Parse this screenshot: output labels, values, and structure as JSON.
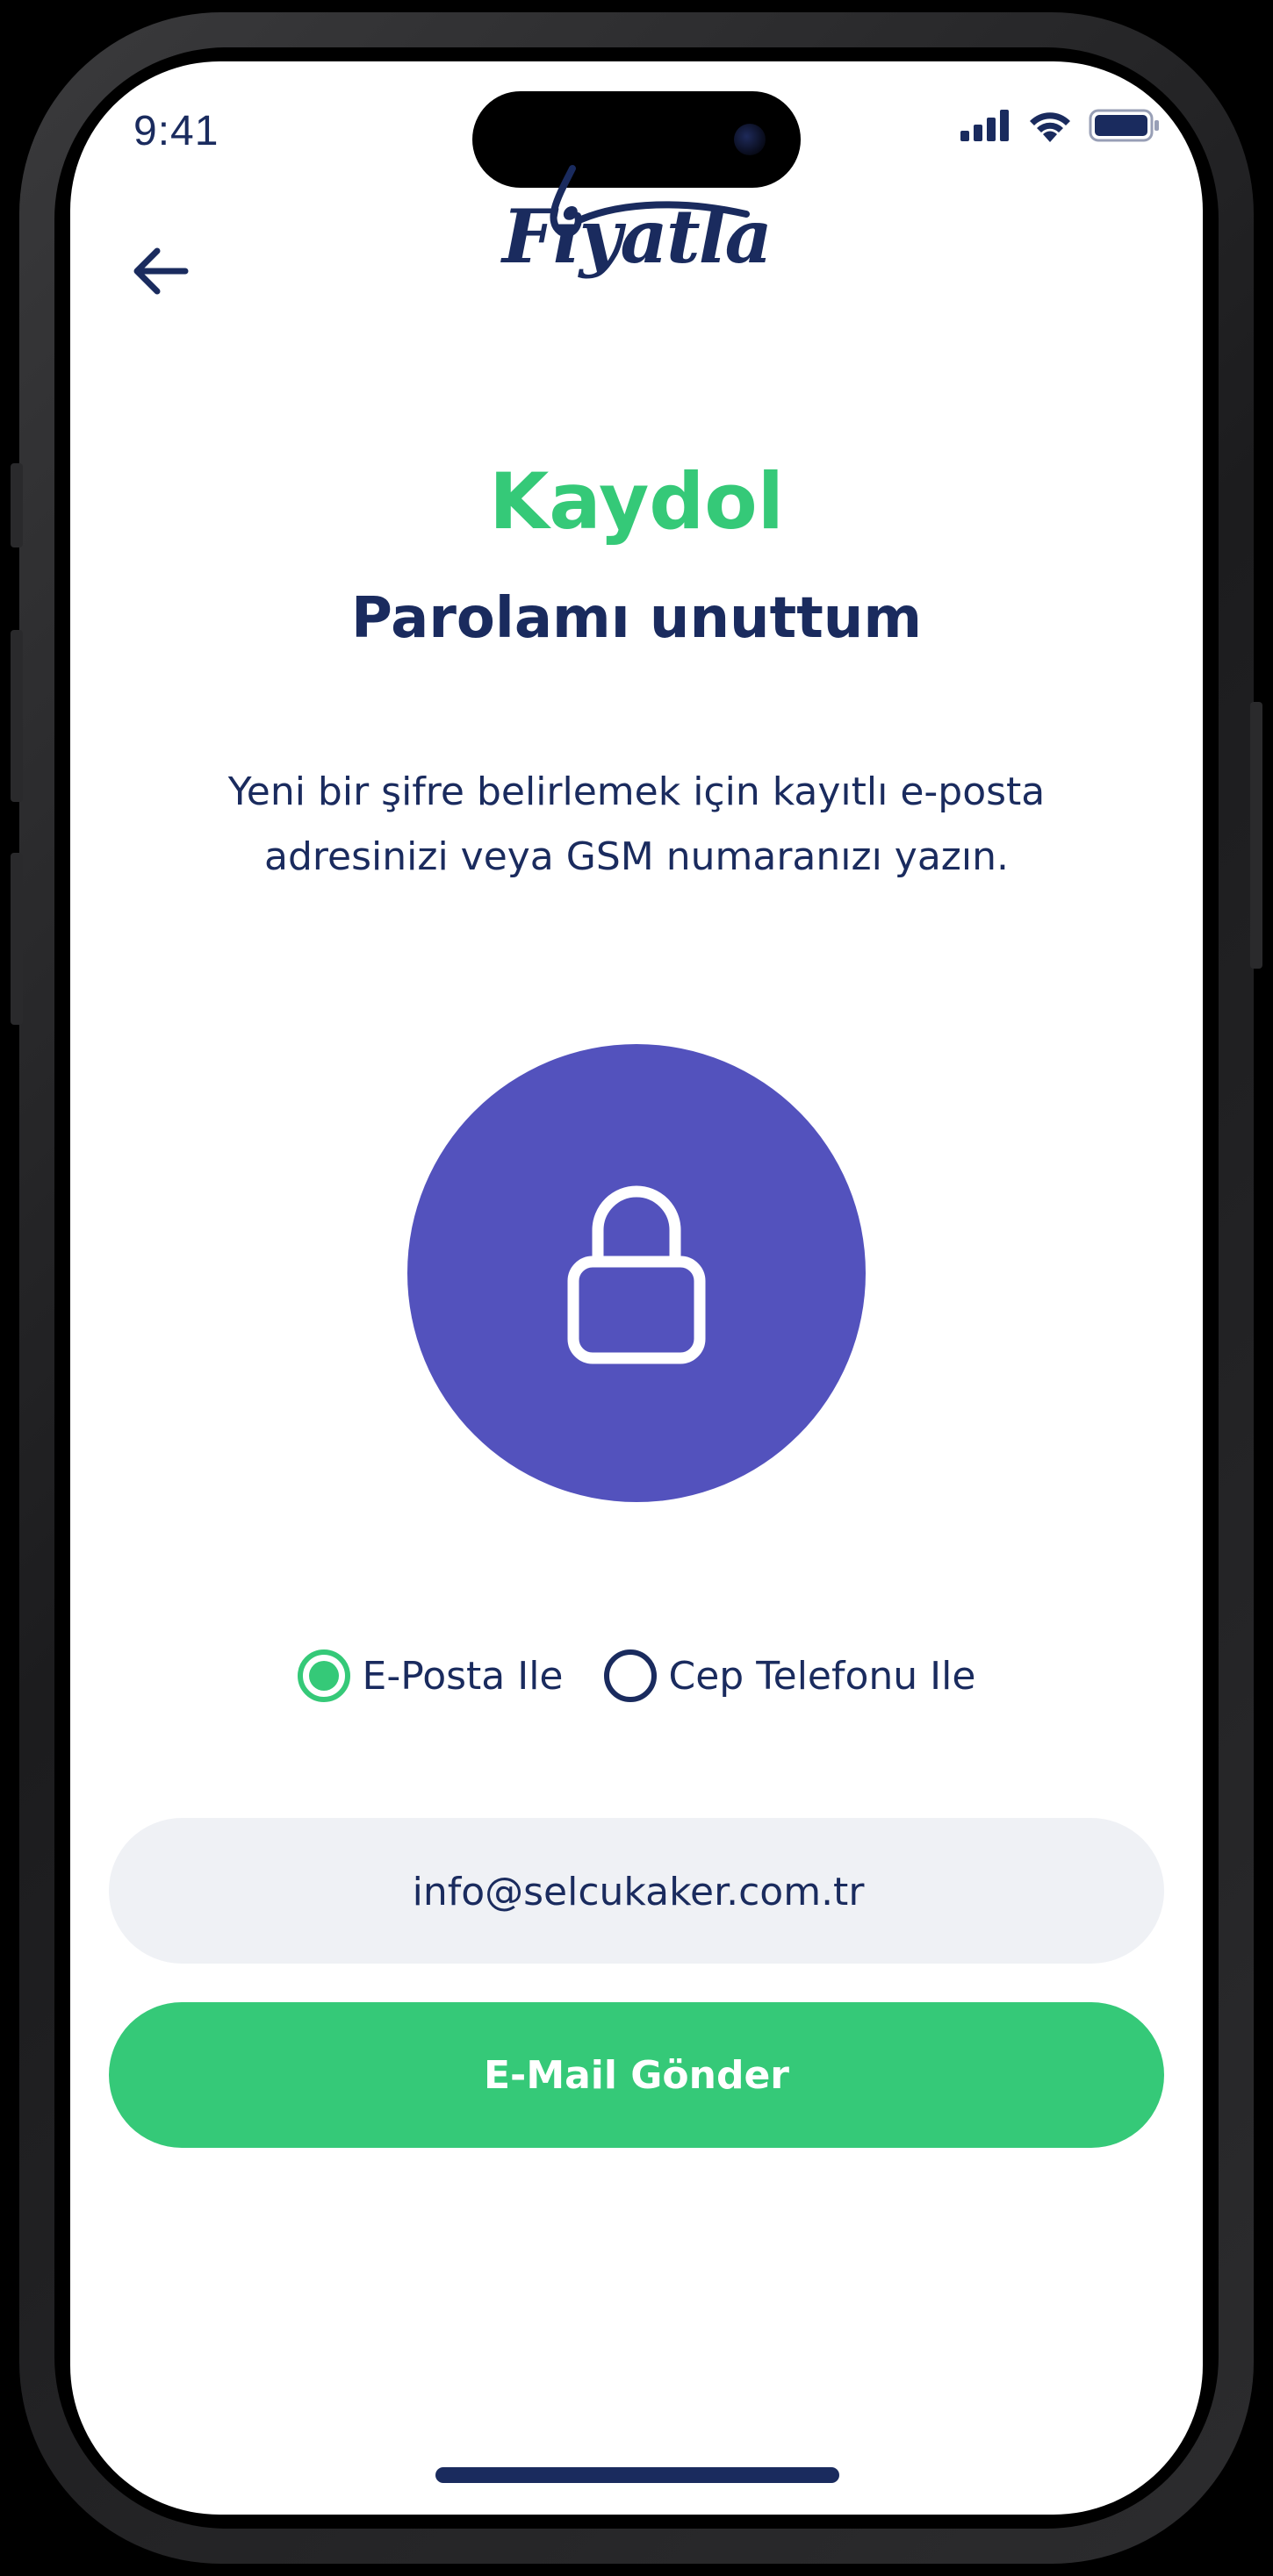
{
  "status_bar": {
    "time": "9:41"
  },
  "header": {
    "logo_text": "Fiyatla",
    "back_icon": "arrow-left-icon"
  },
  "main": {
    "title": "Kaydol",
    "subtitle": "Parolamı unuttum",
    "description": "Yeni bir şifre belirlemek için kayıtlı e-posta adresinizi veya GSM numaranızı yazın.",
    "illustration_icon": "lock-icon"
  },
  "method_options": [
    {
      "label": "E-Posta Ile",
      "selected": true
    },
    {
      "label": "Cep Telefonu Ile",
      "selected": false
    }
  ],
  "form": {
    "email_value": "info@selcukaker.com.tr",
    "submit_label": "E-Mail Gönder"
  },
  "colors": {
    "primary_green": "#35c978",
    "navy": "#1a2b5e",
    "lock_purple": "#5352bd",
    "input_bg": "#eff1f5"
  }
}
